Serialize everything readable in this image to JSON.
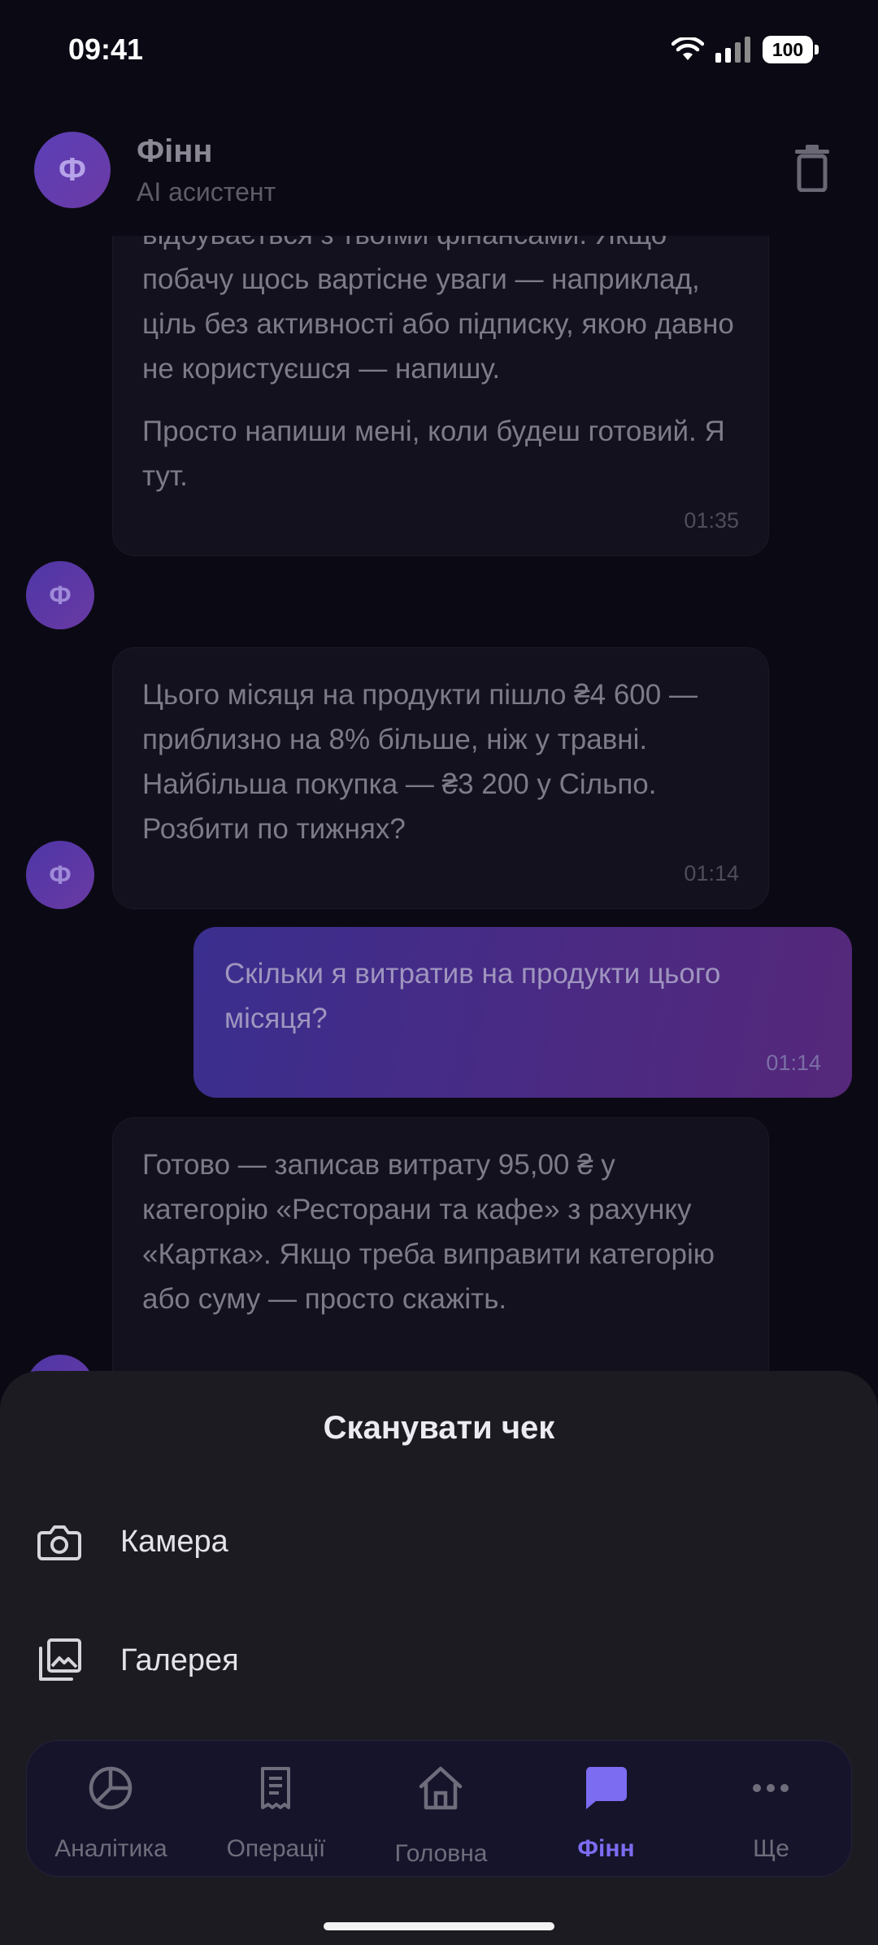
{
  "status": {
    "time": "09:41",
    "battery": "100"
  },
  "header": {
    "avatar_letter": "Ф",
    "name": "Фінн",
    "subtitle": "AI асистент"
  },
  "messages": {
    "m1": {
      "p1": "відбувається з твоїми фінансами. Якщо побачу щось вартісне уваги — наприклад, ціль без активності або підписку, якою давно не користуєшся — напишу.",
      "p2": "Просто напиши мені, коли будеш готовий. Я тут.",
      "time": "01:35"
    },
    "m2": {
      "text": "Цього місяця на продукти пішло ₴4 600 — приблизно на 8% більше, ніж у травні. Найбільша покупка — ₴3 200 у Сільпо. Розбити по тижнях?",
      "time": "01:14"
    },
    "m3": {
      "text": "Скільки я витратив на продукти цього місяця?",
      "time": "01:14"
    },
    "m4": {
      "text": "Готово — записав витрату 95,00 ₴ у категорію «Ресторани та кафе» з рахунку «Картка». Якщо треба виправити категорію або суму — просто скажіть."
    },
    "avatar_letter": "Ф"
  },
  "sheet": {
    "title": "Сканувати чек",
    "items": [
      {
        "label": "Камера",
        "icon": "camera-icon"
      },
      {
        "label": "Галерея",
        "icon": "gallery-icon"
      }
    ]
  },
  "nav": {
    "items": [
      {
        "label": "Аналітика",
        "icon": "pie-chart-icon"
      },
      {
        "label": "Операції",
        "icon": "receipt-icon"
      },
      {
        "label": "Головна",
        "icon": "home-icon"
      },
      {
        "label": "Фінн",
        "icon": "chat-bubble-icon",
        "active": true
      },
      {
        "label": "Ще",
        "icon": "more-dots-icon"
      }
    ]
  },
  "colors": {
    "accent": "#7c6cf2",
    "background": "#0b0a14",
    "sheet": "#1c1b22"
  }
}
